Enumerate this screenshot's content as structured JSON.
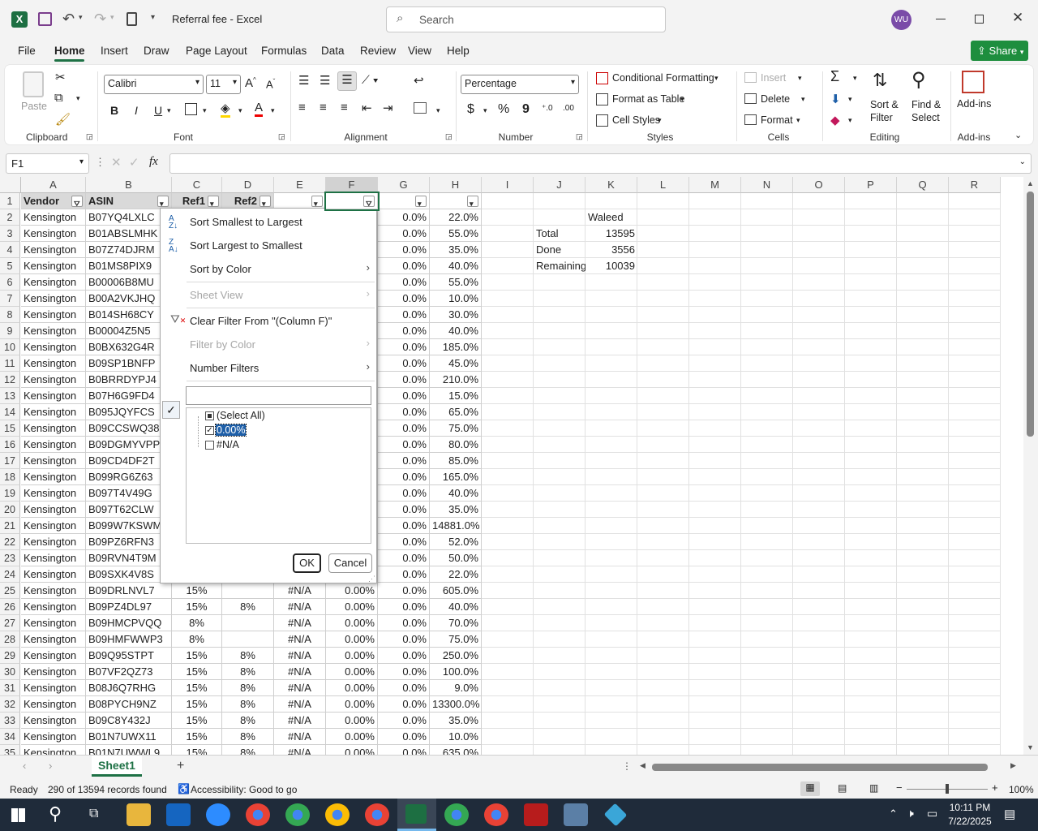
{
  "window": {
    "title": "Referral fee  -  Excel",
    "search_placeholder": "Search",
    "user_initials": "WU"
  },
  "menu": [
    "File",
    "Home",
    "Insert",
    "Draw",
    "Page Layout",
    "Formulas",
    "Data",
    "Review",
    "View",
    "Help"
  ],
  "share_label": "Share",
  "ribbon": {
    "clipboard": {
      "paste": "Paste",
      "label": "Clipboard"
    },
    "font": {
      "name": "Calibri",
      "size": "11",
      "label": "Font",
      "bold": "B",
      "italic": "I",
      "underline": "U"
    },
    "alignment": {
      "label": "Alignment"
    },
    "number": {
      "format": "Percentage",
      "label": "Number",
      "currency": "$",
      "percent": "%",
      "comma": "9"
    },
    "styles": {
      "conditional": "Conditional Formatting",
      "format_table": "Format as Table",
      "cell_styles": "Cell Styles",
      "label": "Styles"
    },
    "cells": {
      "insert": "Insert",
      "delete": "Delete",
      "format": "Format",
      "label": "Cells"
    },
    "editing": {
      "sort_filter": "Sort &\nFilter",
      "find_select": "Find &\nSelect",
      "label": "Editing"
    },
    "addins": {
      "button": "Add-ins",
      "label": "Add-ins"
    }
  },
  "formula_bar": {
    "name_box": "F1",
    "formula": "",
    "fx": "fx"
  },
  "columns": [
    "A",
    "B",
    "C",
    "D",
    "E",
    "F",
    "G",
    "H",
    "I",
    "J",
    "K",
    "L",
    "M",
    "N",
    "O",
    "P",
    "Q",
    "R"
  ],
  "header_row": {
    "A": "Vendor",
    "B": "ASIN",
    "C": "Ref1",
    "D": "Ref2",
    "E": "",
    "F": "",
    "G": "",
    "H": ""
  },
  "rows": [
    {
      "n": "2",
      "a": "Kensington",
      "b": "B07YQ4LXLC",
      "g": "0.0%",
      "h": "22.0%"
    },
    {
      "n": "3",
      "a": "Kensington",
      "b": "B01ABSLMHK",
      "g": "0.0%",
      "h": "55.0%"
    },
    {
      "n": "4",
      "a": "Kensington",
      "b": "B07Z74DJRM",
      "g": "0.0%",
      "h": "35.0%"
    },
    {
      "n": "5",
      "a": "Kensington",
      "b": "B01MS8PIX9",
      "g": "0.0%",
      "h": "40.0%"
    },
    {
      "n": "6",
      "a": "Kensington",
      "b": "B00006B8MU",
      "g": "0.0%",
      "h": "55.0%"
    },
    {
      "n": "7",
      "a": "Kensington",
      "b": "B00A2VKJHQ",
      "g": "0.0%",
      "h": "10.0%"
    },
    {
      "n": "8",
      "a": "Kensington",
      "b": "B014SH68CY",
      "g": "0.0%",
      "h": "30.0%"
    },
    {
      "n": "9",
      "a": "Kensington",
      "b": "B00004Z5N5",
      "g": "0.0%",
      "h": "40.0%"
    },
    {
      "n": "10",
      "a": "Kensington",
      "b": "B0BX632G4R",
      "g": "0.0%",
      "h": "185.0%"
    },
    {
      "n": "11",
      "a": "Kensington",
      "b": "B09SP1BNFP",
      "g": "0.0%",
      "h": "45.0%"
    },
    {
      "n": "12",
      "a": "Kensington",
      "b": "B0BRRDYPJ4",
      "g": "0.0%",
      "h": "210.0%"
    },
    {
      "n": "13",
      "a": "Kensington",
      "b": "B07H6G9FD4",
      "g": "0.0%",
      "h": "15.0%"
    },
    {
      "n": "14",
      "a": "Kensington",
      "b": "B095JQYFCS",
      "g": "0.0%",
      "h": "65.0%"
    },
    {
      "n": "15",
      "a": "Kensington",
      "b": "B09CCSWQ38",
      "g": "0.0%",
      "h": "75.0%"
    },
    {
      "n": "16",
      "a": "Kensington",
      "b": "B09DGMYVPP",
      "g": "0.0%",
      "h": "80.0%"
    },
    {
      "n": "17",
      "a": "Kensington",
      "b": "B09CD4DF2T",
      "g": "0.0%",
      "h": "85.0%"
    },
    {
      "n": "18",
      "a": "Kensington",
      "b": "B099RG6Z63",
      "g": "0.0%",
      "h": "165.0%"
    },
    {
      "n": "19",
      "a": "Kensington",
      "b": "B097T4V49G",
      "g": "0.0%",
      "h": "40.0%"
    },
    {
      "n": "20",
      "a": "Kensington",
      "b": "B097T62CLW",
      "g": "0.0%",
      "h": "35.0%"
    },
    {
      "n": "21",
      "a": "Kensington",
      "b": "B099W7KSWM",
      "g": "0.0%",
      "h": "14881.0%"
    },
    {
      "n": "22",
      "a": "Kensington",
      "b": "B09PZ6RFN3",
      "g": "0.0%",
      "h": "52.0%"
    },
    {
      "n": "23",
      "a": "Kensington",
      "b": "B09RVN4T9M",
      "g": "0.0%",
      "h": "50.0%"
    },
    {
      "n": "24",
      "a": "Kensington",
      "b": "B09SXK4V8S",
      "g": "0.0%",
      "h": "22.0%"
    },
    {
      "n": "25",
      "a": "Kensington",
      "b": "B09DRLNVL7",
      "c": "15%",
      "d": "",
      "e": "#N/A",
      "f": "0.00%",
      "g": "0.0%",
      "h": "605.0%"
    },
    {
      "n": "26",
      "a": "Kensington",
      "b": "B09PZ4DL97",
      "c": "15%",
      "d": "8%",
      "e": "#N/A",
      "f": "0.00%",
      "g": "0.0%",
      "h": "40.0%"
    },
    {
      "n": "27",
      "a": "Kensington",
      "b": "B09HMCPVQQ",
      "c": "8%",
      "d": "",
      "e": "#N/A",
      "f": "0.00%",
      "g": "0.0%",
      "h": "70.0%"
    },
    {
      "n": "28",
      "a": "Kensington",
      "b": "B09HMFWWP3",
      "c": "8%",
      "d": "",
      "e": "#N/A",
      "f": "0.00%",
      "g": "0.0%",
      "h": "75.0%"
    },
    {
      "n": "29",
      "a": "Kensington",
      "b": "B09Q95STPT",
      "c": "15%",
      "d": "8%",
      "e": "#N/A",
      "f": "0.00%",
      "g": "0.0%",
      "h": "250.0%"
    },
    {
      "n": "30",
      "a": "Kensington",
      "b": "B07VF2QZ73",
      "c": "15%",
      "d": "8%",
      "e": "#N/A",
      "f": "0.00%",
      "g": "0.0%",
      "h": "100.0%"
    },
    {
      "n": "31",
      "a": "Kensington",
      "b": "B08J6Q7RHG",
      "c": "15%",
      "d": "8%",
      "e": "#N/A",
      "f": "0.00%",
      "g": "0.0%",
      "h": "9.0%"
    },
    {
      "n": "32",
      "a": "Kensington",
      "b": "B08PYCH9NZ",
      "c": "15%",
      "d": "8%",
      "e": "#N/A",
      "f": "0.00%",
      "g": "0.0%",
      "h": "13300.0%"
    },
    {
      "n": "33",
      "a": "Kensington",
      "b": "B09C8Y432J",
      "c": "15%",
      "d": "8%",
      "e": "#N/A",
      "f": "0.00%",
      "g": "0.0%",
      "h": "35.0%"
    },
    {
      "n": "34",
      "a": "Kensington",
      "b": "B01N7UWX11",
      "c": "15%",
      "d": "8%",
      "e": "#N/A",
      "f": "0.00%",
      "g": "0.0%",
      "h": "10.0%"
    },
    {
      "n": "35",
      "a": "Kensington",
      "b": "B01N7UWWL9",
      "c": "15%",
      "d": "8%",
      "e": "#N/A",
      "f": "0.00%",
      "g": "0.0%",
      "h": "635.0%"
    }
  ],
  "summary": {
    "k2": "Waleed",
    "j3": "Total",
    "k3": "13595",
    "j4": "Done",
    "k4": "3556",
    "j5": "Remaining",
    "k5": "10039"
  },
  "filter_menu": {
    "sort_asc": "Sort Smallest to Largest",
    "sort_desc": "Sort Largest to Smallest",
    "sort_color": "Sort by Color",
    "sheet_view": "Sheet View",
    "clear_filter": "Clear Filter From \"(Column F)\"",
    "filter_color": "Filter by Color",
    "number_filters": "Number Filters",
    "search_value": "",
    "items": [
      {
        "label": "(Select All)",
        "state": "partial"
      },
      {
        "label": "0.00%",
        "state": "checked"
      },
      {
        "label": "#N/A",
        "state": "unchecked"
      }
    ],
    "ok": "OK",
    "cancel": "Cancel"
  },
  "sheet_tab": "Sheet1",
  "status": {
    "ready": "Ready",
    "records": "290 of 13594 records found",
    "accessibility": "Accessibility: Good to go",
    "zoom": "100%"
  },
  "taskbar": {
    "time": "10:11 PM",
    "date": "7/22/2025"
  },
  "colors": {
    "excel_green": "#217346",
    "accent": "#1e7145",
    "share_bg": "#1e8e3e"
  }
}
